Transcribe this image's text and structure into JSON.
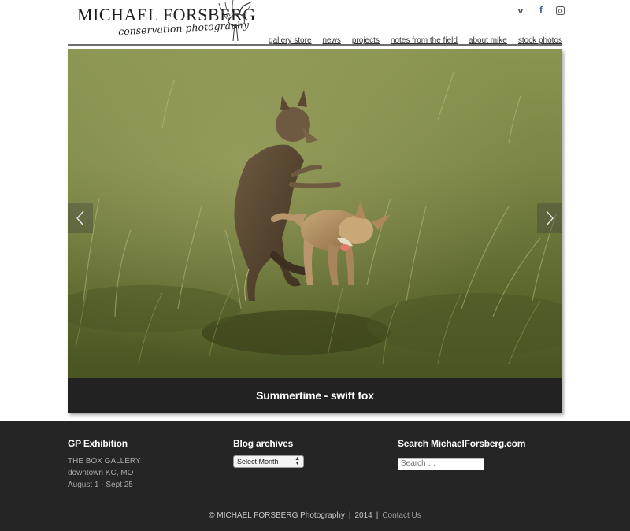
{
  "header": {
    "logo_name": "MICHAEL FORSBERG",
    "logo_tagline": "conservation photography"
  },
  "social": {
    "vimeo": "v",
    "facebook": "f"
  },
  "nav": {
    "items": [
      "gallery store",
      "news",
      "projects",
      "notes from the field",
      "about mike",
      "stock photos"
    ]
  },
  "slider": {
    "caption": "Summertime - swift fox"
  },
  "footer": {
    "exhibition": {
      "title": "GP Exhibition",
      "lines": [
        "THE BOX GALLERY",
        "downtown KC, MO",
        "August 1 - Sept 25"
      ]
    },
    "archives": {
      "title": "Blog archives",
      "select_value": "Select Month"
    },
    "search": {
      "title": "Search MichaelForsberg.com",
      "placeholder": "Search …"
    },
    "copyright": "© MICHAEL FORSBERG Photography",
    "year": "2014",
    "separator": "|",
    "contact": "Contact Us"
  },
  "colors": {
    "footer_bg": "#252525",
    "caption_bg": "#222222",
    "grass": "#6f7a3c"
  }
}
